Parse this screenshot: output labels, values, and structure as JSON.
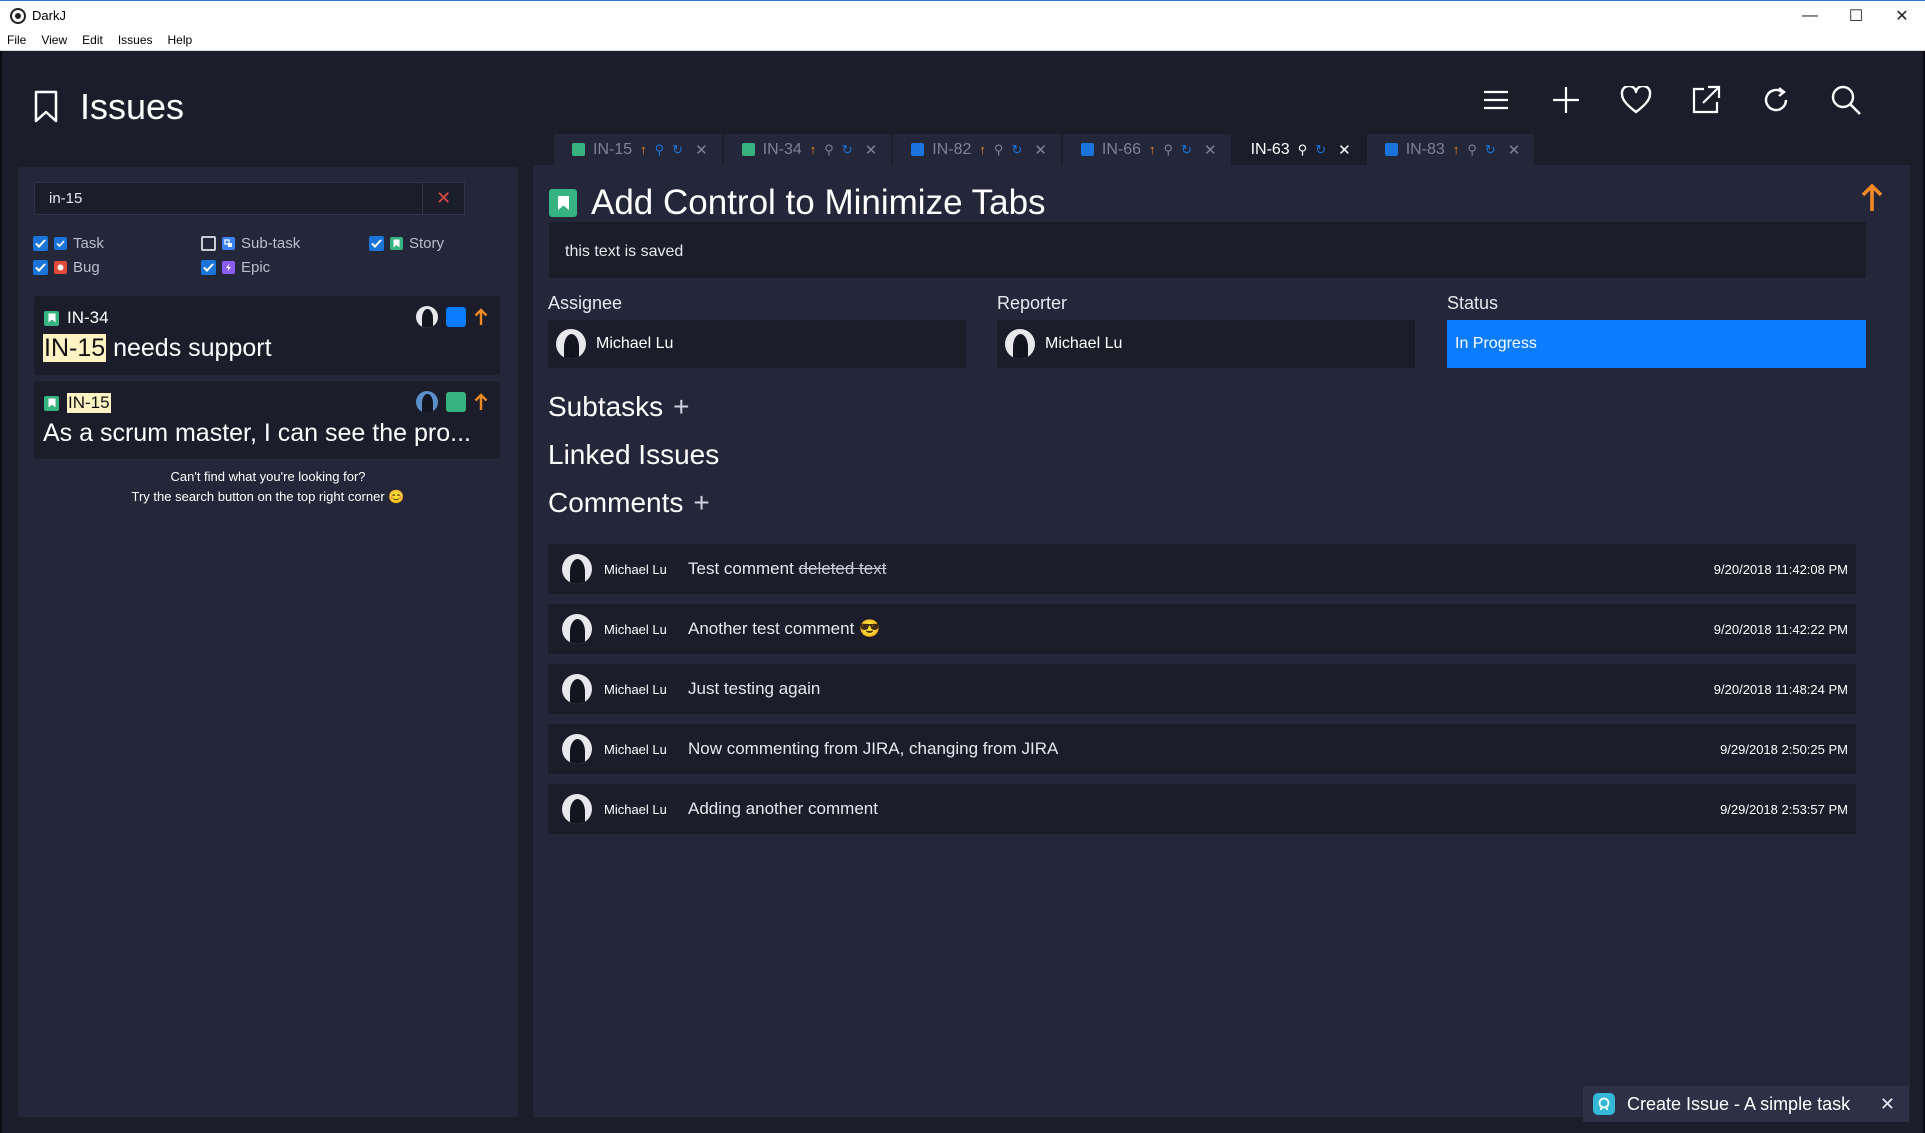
{
  "window": {
    "title": "DarkJ",
    "minimize": "—",
    "maximize": "☐",
    "close": "✕"
  },
  "menu": [
    "File",
    "View",
    "Edit",
    "Issues",
    "Help"
  ],
  "header": {
    "title": "Issues",
    "tools": [
      "menu-icon",
      "plus-icon",
      "heart-icon",
      "external-link-icon",
      "refresh-icon",
      "search-icon"
    ]
  },
  "sidebar": {
    "search_value": "in-15",
    "clear": "✕",
    "filters": [
      {
        "label": "Task",
        "checked": true,
        "color": "#1a74d9"
      },
      {
        "label": "Sub-task",
        "checked": false,
        "color": "#3b82f6"
      },
      {
        "label": "Story",
        "checked": true,
        "color": "#36b37e"
      },
      {
        "label": "Bug",
        "checked": true,
        "color": "#e5493a"
      },
      {
        "label": "Epic",
        "checked": true,
        "color": "#8b5cf6"
      }
    ],
    "results": [
      {
        "key": "IN-34",
        "summary_highlight": "IN-15",
        "summary_rest": " needs support",
        "status_color": "#0a7cff"
      },
      {
        "key": "IN-15",
        "summary": "As a scrum master, I can see the pro...",
        "status_color": "#36b37e"
      }
    ],
    "help_line1": "Can't find what you're looking for?",
    "help_line2": "Try the search button on the top right corner 😊"
  },
  "tabs": [
    {
      "key": "IN-15",
      "type": "story",
      "active": false
    },
    {
      "key": "IN-34",
      "type": "story",
      "active": false
    },
    {
      "key": "IN-82",
      "type": "task",
      "active": false
    },
    {
      "key": "IN-66",
      "type": "task",
      "active": false
    },
    {
      "key": "IN-63",
      "type": "none",
      "active": true
    },
    {
      "key": "IN-83",
      "type": "task",
      "active": false
    }
  ],
  "issue": {
    "title": "Add Control to Minimize Tabs",
    "description": "this text is saved",
    "assignee_label": "Assignee",
    "assignee": "Michael Lu",
    "reporter_label": "Reporter",
    "reporter": "Michael Lu",
    "status_label": "Status",
    "status": "In Progress",
    "subtasks_label": "Subtasks",
    "linked_label": "Linked Issues",
    "comments_label": "Comments",
    "comments": [
      {
        "author": "Michael Lu",
        "text": "Test comment ",
        "struck": "deleted text",
        "time": "9/20/2018 11:42:08 PM"
      },
      {
        "author": "Michael Lu",
        "text": "Another test comment 😎",
        "struck": "",
        "time": "9/20/2018 11:42:22 PM"
      },
      {
        "author": "Michael Lu",
        "text": "Just testing again",
        "struck": "",
        "time": "9/20/2018 11:48:24 PM"
      },
      {
        "author": "Michael Lu",
        "text": "Now commenting from JIRA, changing from JIRA",
        "struck": "",
        "time": "9/29/2018 2:50:25 PM"
      },
      {
        "author": "Michael Lu",
        "text": "Adding another comment",
        "struck": "",
        "time": "9/29/2018 2:53:57 PM"
      }
    ]
  },
  "toast": {
    "text": "Create Issue - A simple task",
    "close": "✕"
  },
  "colors": {
    "accent": "#0a7cff",
    "priority": "#f08a24",
    "story": "#36b37e",
    "task": "#1a74d9"
  }
}
